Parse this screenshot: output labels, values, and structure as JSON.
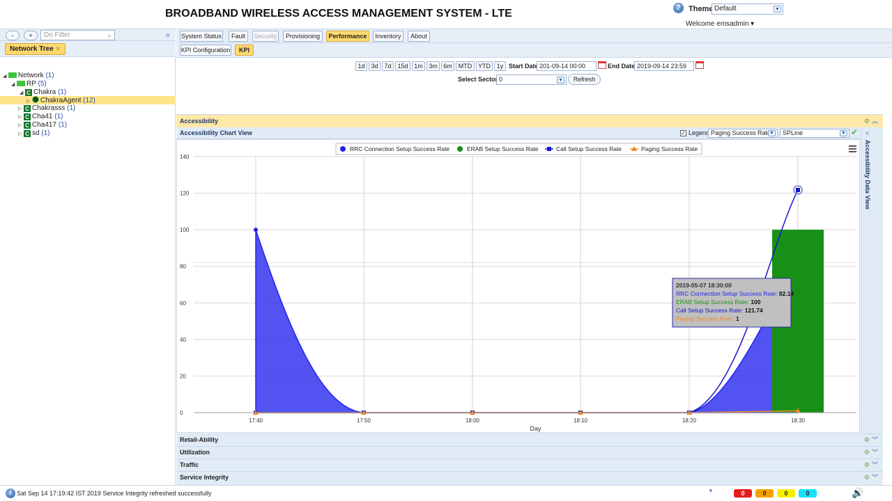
{
  "header": {
    "title": "BROADBAND WIRELESS ACCESS MANAGEMENT SYSTEM - LTE",
    "theme_label": "Theme",
    "theme_value": "Default",
    "welcome": "Welcome emsadmin ▾"
  },
  "left": {
    "collapse": "«",
    "tab_label": "Network Tree",
    "filter_minus": "-",
    "filter_plus": "+",
    "filter_placeholder": "Do Filter",
    "tree": [
      {
        "label": "Network",
        "count": "(1)"
      },
      {
        "label": "RP",
        "count": "(5)"
      },
      {
        "label": "Chakra",
        "count": "(1)"
      },
      {
        "label": "ChakraAgent",
        "count": "(12)"
      },
      {
        "label": "Chakrasss",
        "count": "(1)"
      },
      {
        "label": "Cha41",
        "count": "(1)"
      },
      {
        "label": "Cha417",
        "count": "(1)"
      },
      {
        "label": "sd",
        "count": "(1)"
      }
    ]
  },
  "nav": {
    "tabs": [
      "System Status",
      "Fault",
      "Security",
      "Provisioning",
      "Performance",
      "Inventory",
      "About"
    ],
    "active": "Performance",
    "subtabs": [
      "KPI Configuration",
      "KPI"
    ]
  },
  "toolbar": {
    "ranges": [
      "1d",
      "3d",
      "7d",
      "15d",
      "1m",
      "3m",
      "6m",
      "MTD",
      "YTD",
      "1y"
    ],
    "start_label": "Start Date",
    "start_value": "201-09-14 00:00",
    "end_label": "End Date",
    "end_value": "2019-09-14 23:59",
    "sector_label": "Select Sector",
    "sector_value": "0",
    "refresh": "Refresh"
  },
  "sections": {
    "accessibility": "Accessibility",
    "chart_view": "Accessibility Chart View",
    "legend_label": "Legend",
    "metric_select": "Paging Success Rate",
    "type_select": "SPLine",
    "data_view": "Accessibility Data View",
    "retainability": "Retail-Ability",
    "utilization": "Utilization",
    "traffic": "Traffic",
    "integrity": "Service Integrity"
  },
  "tooltip": {
    "title": "2019-05-07 18:30:00",
    "rows": [
      {
        "label": "RRC Connection Setup Success Rate",
        "value": "82.14",
        "color": "#2222ee"
      },
      {
        "label": "ERAB Setup Success Rate",
        "value": "100",
        "color": "#189018"
      },
      {
        "label": "Call Setup Success Rate",
        "value": "121.74",
        "color": "#1414c8"
      },
      {
        "label": "Paging Success Rate",
        "value": "1",
        "color": "#f08a24"
      }
    ]
  },
  "chart_data": {
    "type": "line",
    "categories": [
      "17:40",
      "17:50",
      "18:00",
      "18:10",
      "18:20",
      "18:30"
    ],
    "xlabel": "Day",
    "ylabel": "",
    "ylim": [
      0,
      140
    ],
    "yticks": [
      0,
      20,
      40,
      60,
      80,
      100,
      120,
      140
    ],
    "grid": true,
    "legend_position": "top",
    "series": [
      {
        "name": "RRC Connection Setup Success Rate",
        "kind": "area",
        "color": "#2222ee",
        "values": [
          100,
          0,
          0,
          0,
          0,
          82.14
        ]
      },
      {
        "name": "ERAB Setup Success Rate",
        "kind": "bar",
        "color": "#189018",
        "values": [
          0,
          0,
          0,
          0,
          0,
          100
        ]
      },
      {
        "name": "Call Setup Success Rate",
        "kind": "line",
        "color": "#1414c8",
        "values": [
          0,
          0,
          0,
          0,
          0,
          121.74
        ]
      },
      {
        "name": "Paging Success Rate",
        "kind": "line",
        "color": "#f08a24",
        "values": [
          0,
          0,
          0,
          0,
          0,
          1
        ]
      }
    ]
  },
  "status": {
    "message": "Sat Sep 14 17:19:42 IST 2019 Service Integrity refreshed successfully",
    "alarms": [
      {
        "value": "0",
        "color": "#e41c1c"
      },
      {
        "value": "0",
        "color": "#f5a100"
      },
      {
        "value": "0",
        "color": "#f5f000"
      },
      {
        "value": "0",
        "color": "#19e0f5"
      }
    ]
  }
}
